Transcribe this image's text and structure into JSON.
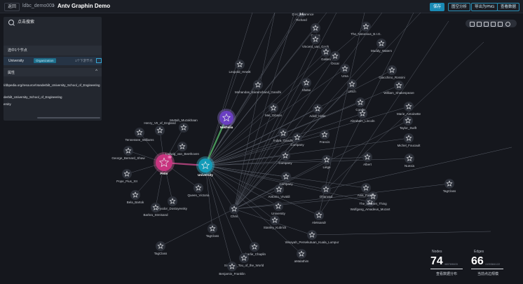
{
  "header": {
    "back_label": "返回",
    "crumb": "ldbc_demo001",
    "crumb_sep": ">",
    "title": "Antv Graphin Demo",
    "buttons": [
      "保存",
      "图空分析",
      "导出为PNG",
      "查看数据"
    ]
  },
  "panel": {
    "search_placeholder": "点击搜索",
    "selected_count": "选中1个节点",
    "selected_node": {
      "name": "University",
      "type": "Organization",
      "action": "1个下游节点"
    },
    "section_title": "属性",
    "collapse_glyph": "^",
    "properties": [
      "//dbpedia.org/resource/Vanderbilt_University_School_of_Engineering",
      "derbilt_University_School_of_Engineering",
      "ersity"
    ]
  },
  "stats": {
    "nodes_label": "Nodes",
    "nodes_value": "74",
    "nodes_sub": "/88769603",
    "nodes_caption": "查看数据分布",
    "edges_label": "Edges",
    "edges_value": "66",
    "edges_sub": "/109384122",
    "edges_caption": "当前点边规模"
  },
  "graph": {
    "nodes": [
      {
        "label": "Peter",
        "kind": "pink",
        "badge": "66"
      },
      {
        "label": "University",
        "kind": "cyan"
      },
      {
        "label": "Nakhelia",
        "kind": "purple"
      },
      {
        "label": "Henry_VII_of_England"
      },
      {
        "label": "Muttah_Muzakhaan"
      },
      {
        "label": "Tennessee_Williams"
      },
      {
        "label": "Ludwig_van_Beethoven"
      },
      {
        "label": "George_Bernard_Shaw"
      },
      {
        "label": "Pope_Pius_XII"
      },
      {
        "label": "Bela_Bartok"
      },
      {
        "label": "Barbra_Streisand"
      },
      {
        "label": "Fyodor_Dostoyevsky"
      },
      {
        "label": "Queen_Victoria"
      },
      {
        "label": "Chris"
      },
      {
        "label": "TagClass"
      },
      {
        "label": "TagClass"
      },
      {
        "label": "Stanley_Kubrick"
      },
      {
        "label": "Company"
      },
      {
        "label": "Charlie_Chaplin"
      },
      {
        "label": "Sirimavo_Tou_of_the_World"
      },
      {
        "label": "Benjamin_Franklin"
      },
      {
        "label": "Wisayah_Persekutuan_Kuala_Lumpur"
      },
      {
        "label": "aMalathim"
      },
      {
        "label": "Aleksandr"
      },
      {
        "label": "Antonio_Vivaldi"
      },
      {
        "label": "Company"
      },
      {
        "label": "University"
      },
      {
        "label": "Company"
      },
      {
        "label": "Dhanvad"
      },
      {
        "label": "Wolfgang_Amadeus_Mozart"
      },
      {
        "label": "The_Internet_Thing"
      },
      {
        "label": "Asia_Pacific"
      },
      {
        "label": "Indira_Gandhi"
      },
      {
        "label": "Mel_Gibson"
      },
      {
        "label": "Mohandas_Karamchand_Gandhi"
      },
      {
        "label": "Leopold_Hewitt"
      },
      {
        "label": "Sfaltoi"
      },
      {
        "label": "Adolf_Hitler"
      },
      {
        "label": "Francis"
      },
      {
        "label": "Liège"
      },
      {
        "label": "Abraham_Lincoln"
      },
      {
        "label": "Marie_Antoinette"
      },
      {
        "label": "Taylor_Swift"
      },
      {
        "label": "Michel_Foucault"
      },
      {
        "label": "Nuexia"
      },
      {
        "label": "TagClass"
      },
      {
        "label": "William_Shakespeare"
      },
      {
        "label": "Giacchino_Rossini"
      },
      {
        "label": "Muddy_Waters"
      },
      {
        "label": "The_Notorious_B.I.G."
      },
      {
        "label": "Carlos"
      },
      {
        "label": "Vincent_van_Gogh"
      },
      {
        "label": "Richard"
      },
      {
        "label": "D.H._Lawrence"
      },
      {
        "label": "Oscar"
      },
      {
        "label": "Galileo"
      },
      {
        "label": "Uma"
      },
      {
        "label": "Ulrich"
      },
      {
        "label": "Conde"
      },
      {
        "label": "Albert"
      }
    ]
  }
}
